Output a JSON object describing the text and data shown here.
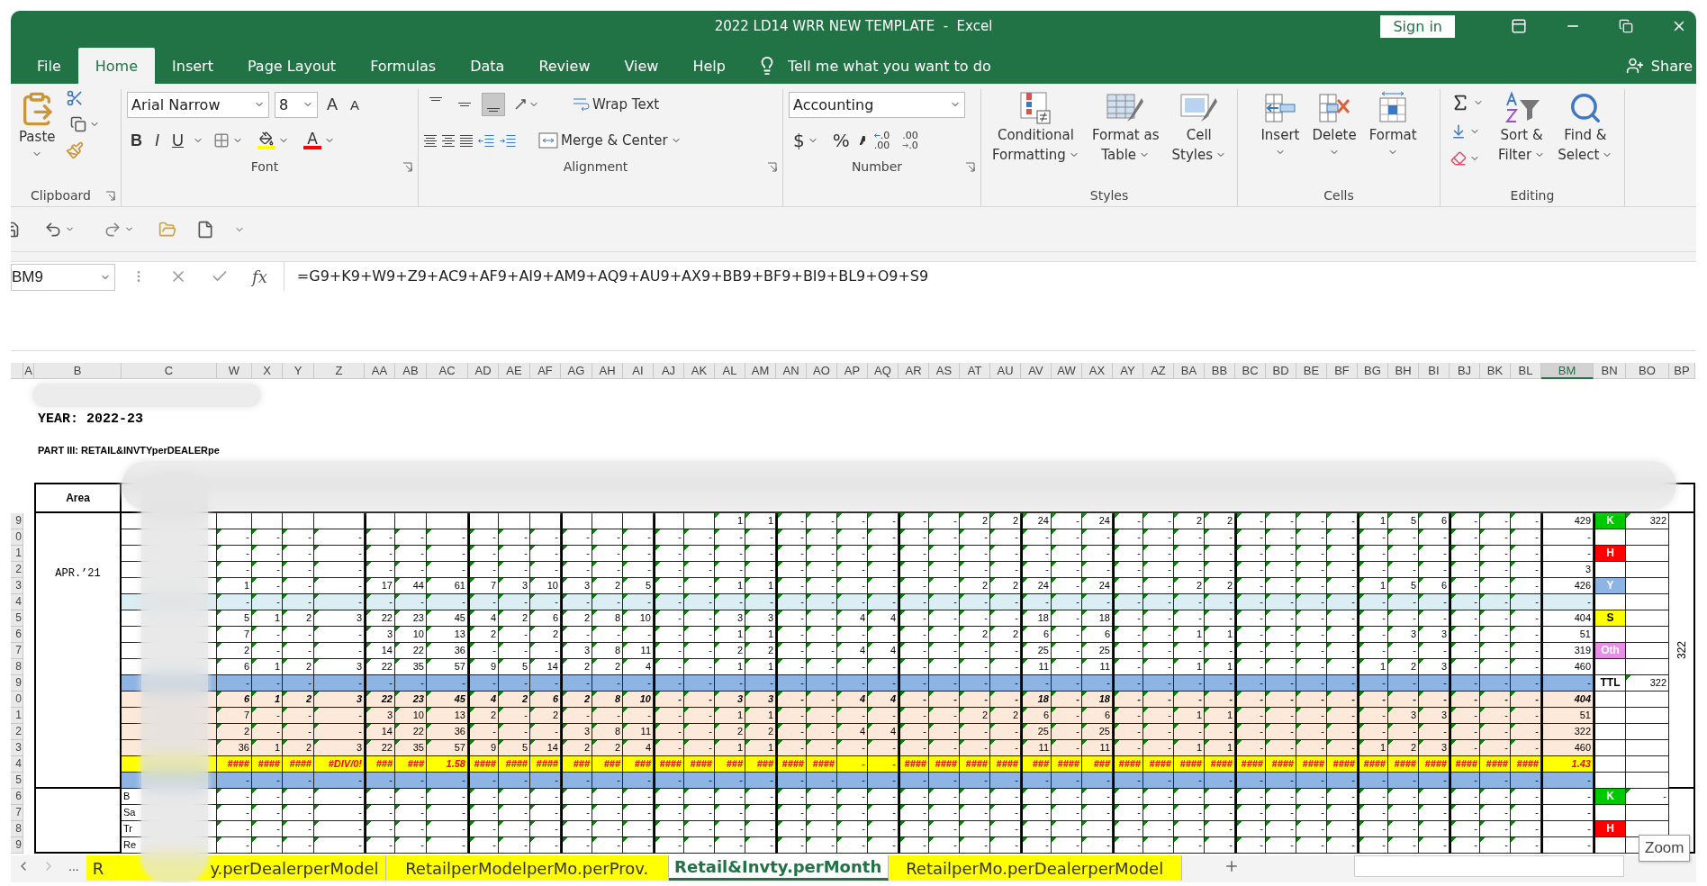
{
  "window": {
    "title": "2022 LD14 WRR NEW TEMPLATE  -  Excel",
    "sign_in": "Sign in"
  },
  "menu_tabs": [
    {
      "label": "File",
      "selected": false
    },
    {
      "label": "Home",
      "selected": true
    },
    {
      "label": "Insert",
      "selected": false
    },
    {
      "label": "Page Layout",
      "selected": false
    },
    {
      "label": "Formulas",
      "selected": false
    },
    {
      "label": "Data",
      "selected": false
    },
    {
      "label": "Review",
      "selected": false
    },
    {
      "label": "View",
      "selected": false
    },
    {
      "label": "Help",
      "selected": false
    }
  ],
  "tell_me": "Tell me what you want to do",
  "share": "Share",
  "ribbon": {
    "clipboard": {
      "label": "Clipboard",
      "paste": "Paste"
    },
    "font": {
      "label": "Font",
      "name": "Arial Narrow",
      "size": "8",
      "grow": "A",
      "shrink": "A",
      "styles": [
        "B",
        "I",
        "U"
      ],
      "color_letter": "A"
    },
    "alignment": {
      "label": "Alignment",
      "vertical": [
        {
          "selected": false
        },
        {
          "selected": false
        },
        {
          "selected": true
        }
      ],
      "wrap": "Wrap Text",
      "merge": "Merge & Center"
    },
    "number": {
      "label": "Number",
      "format": "Accounting",
      "currency": "$",
      "percent": "%",
      "decimals": [
        {
          "kind": "increase",
          "top": ".0",
          "bottom": ".00"
        },
        {
          "kind": "decrease",
          "top": ".00",
          "bottom": ".0"
        }
      ]
    },
    "styles": {
      "label": "Styles",
      "buttons": [
        {
          "kind": "conditional",
          "lines": [
            "Conditional",
            "Formatting"
          ]
        },
        {
          "kind": "table",
          "lines": [
            "Format as",
            "Table"
          ]
        },
        {
          "kind": "cell",
          "lines": [
            "Cell",
            "Styles"
          ]
        }
      ]
    },
    "cells": {
      "label": "Cells",
      "buttons": [
        {
          "kind": "insert",
          "label": "Insert"
        },
        {
          "kind": "delete",
          "label": "Delete"
        },
        {
          "kind": "format",
          "label": "Format"
        }
      ]
    },
    "editing": {
      "label": "Editing",
      "buttons": [
        {
          "kind": "sort",
          "lines": [
            "Sort &",
            "Filter"
          ]
        },
        {
          "kind": "find",
          "lines": [
            "Find &",
            "Select"
          ]
        }
      ]
    }
  },
  "name_box": "BM9",
  "function_label": "fx",
  "formula": "=G9+K9+W9+Z9+AC9+AF9+AI9+AM9+AQ9+AU9+AX9+BB9+BF9+BI9+BL9+O9+S9",
  "sheet": {
    "columns": [
      {
        "label": "A",
        "selected": false
      },
      {
        "label": "B",
        "selected": false
      },
      {
        "label": "C",
        "selected": false
      },
      {
        "label": "W",
        "selected": false
      },
      {
        "label": "X",
        "selected": false
      },
      {
        "label": "Y",
        "selected": false
      },
      {
        "label": "Z",
        "selected": false
      },
      {
        "label": "AA",
        "selected": false
      },
      {
        "label": "AB",
        "selected": false
      },
      {
        "label": "AC",
        "selected": false
      },
      {
        "label": "AD",
        "selected": false
      },
      {
        "label": "AE",
        "selected": false
      },
      {
        "label": "AF",
        "selected": false
      },
      {
        "label": "AG",
        "selected": false
      },
      {
        "label": "AH",
        "selected": false
      },
      {
        "label": "AI",
        "selected": false
      },
      {
        "label": "AJ",
        "selected": false
      },
      {
        "label": "AK",
        "selected": false
      },
      {
        "label": "AL",
        "selected": false
      },
      {
        "label": "AM",
        "selected": false
      },
      {
        "label": "AN",
        "selected": false
      },
      {
        "label": "AO",
        "selected": false
      },
      {
        "label": "AP",
        "selected": false
      },
      {
        "label": "AQ",
        "selected": false
      },
      {
        "label": "AR",
        "selected": false
      },
      {
        "label": "AS",
        "selected": false
      },
      {
        "label": "AT",
        "selected": false
      },
      {
        "label": "AU",
        "selected": false
      },
      {
        "label": "AV",
        "selected": false
      },
      {
        "label": "AW",
        "selected": false
      },
      {
        "label": "AX",
        "selected": false
      },
      {
        "label": "AY",
        "selected": false
      },
      {
        "label": "AZ",
        "selected": false
      },
      {
        "label": "BA",
        "selected": false
      },
      {
        "label": "BB",
        "selected": false
      },
      {
        "label": "BC",
        "selected": false
      },
      {
        "label": "BD",
        "selected": false
      },
      {
        "label": "BE",
        "selected": false
      },
      {
        "label": "BF",
        "selected": false
      },
      {
        "label": "BG",
        "selected": false
      },
      {
        "label": "BH",
        "selected": false
      },
      {
        "label": "BI",
        "selected": false
      },
      {
        "label": "BJ",
        "selected": false
      },
      {
        "label": "BK",
        "selected": false
      },
      {
        "label": "BL",
        "selected": false
      },
      {
        "label": "BM",
        "selected": true
      },
      {
        "label": "BN",
        "selected": false
      },
      {
        "label": "BO",
        "selected": false
      },
      {
        "label": "BP",
        "selected": false
      }
    ],
    "year": "YEAR: 2022-23",
    "part": "PART III: RETAIL&INVTYperDEALERpe",
    "area_header": "Area",
    "period": "APR.’21",
    "side_total": "322",
    "rows": [
      {
        "number": "9",
        "kind": "plain",
        "cells": [
          null,
          null,
          null,
          null,
          null,
          null,
          null,
          null,
          null,
          null,
          null,
          null,
          null,
          null,
          null,
          "1",
          "1",
          "-",
          "-",
          "-",
          "-",
          "-",
          "-",
          "2",
          "2",
          "24",
          "-",
          "24",
          "-",
          "-",
          "2",
          "2",
          "-",
          "-",
          "-",
          "-",
          "1",
          "5",
          "6",
          "-",
          "-",
          "-"
        ],
        "total": "429",
        "tag": {
          "text": "K",
          "color": "#00c800"
        },
        "extra": "322"
      },
      {
        "number": "0",
        "kind": "plain",
        "cells": [
          "-",
          "-",
          "-",
          "-",
          "-",
          "-",
          "-",
          "-",
          "-",
          "-",
          "-",
          "-",
          "-",
          "-",
          "-",
          "-",
          "-",
          "-",
          "-",
          "-",
          "-",
          "-",
          "-",
          "-",
          "-",
          "-",
          "-",
          "-",
          "-",
          "-",
          "-",
          "-",
          "-",
          "-",
          "-",
          "-",
          "-",
          "-",
          "-",
          "-",
          "-",
          "-"
        ],
        "total": "-"
      },
      {
        "number": "1",
        "kind": "plain",
        "cells": [
          "-",
          "-",
          "-",
          "-",
          "-",
          "-",
          "-",
          "-",
          "-",
          "-",
          "-",
          "-",
          "-",
          "-",
          "-",
          "-",
          "-",
          "-",
          "-",
          "-",
          "-",
          "-",
          "-",
          "-",
          "-",
          "-",
          "-",
          "-",
          "-",
          "-",
          "-",
          "-",
          "-",
          "-",
          "-",
          "-",
          "-",
          "-",
          "-",
          "-",
          "-",
          "-"
        ],
        "total": "-",
        "tag": {
          "text": "H",
          "color": "#ff0000"
        }
      },
      {
        "number": "2",
        "kind": "plain",
        "cells": [
          "-",
          "-",
          "-",
          "-",
          "-",
          "-",
          "-",
          "-",
          "-",
          "-",
          "-",
          "-",
          "-",
          "-",
          "-",
          "-",
          "-",
          "-",
          "-",
          "-",
          "-",
          "-",
          "-",
          "-",
          "-",
          "-",
          "-",
          "-",
          "-",
          "-",
          "-",
          "-",
          "-",
          "-",
          "-",
          "-",
          "-",
          "-",
          "-",
          "-",
          "-",
          "-"
        ],
        "total": "3"
      },
      {
        "number": "3",
        "kind": "plain",
        "cells": [
          "1",
          "-",
          "-",
          "-",
          "17",
          "44",
          "61",
          "7",
          "3",
          "10",
          "3",
          "2",
          "5",
          "-",
          "-",
          "1",
          "1",
          "-",
          "-",
          "-",
          "-",
          "-",
          "-",
          "2",
          "2",
          "24",
          "-",
          "24",
          "-",
          "-",
          "2",
          "2",
          "-",
          "-",
          "-",
          "-",
          "1",
          "5",
          "6",
          "-",
          "-",
          "-"
        ],
        "total": "426",
        "tag": {
          "text": "Y",
          "color": "#8db4e2"
        }
      },
      {
        "number": "4",
        "kind": "shaded",
        "cells": [
          "-",
          "-",
          "-",
          "-",
          "-",
          "-",
          "-",
          "-",
          "-",
          "-",
          "-",
          "-",
          "-",
          "-",
          "-",
          "-",
          "-",
          "-",
          "-",
          "-",
          "-",
          "-",
          "-",
          "-",
          "-",
          "-",
          "-",
          "-",
          "-",
          "-",
          "-",
          "-",
          "-",
          "-",
          "-",
          "-",
          "-",
          "-",
          "-",
          "-",
          "-",
          "-"
        ],
        "total": "-"
      },
      {
        "number": "5",
        "kind": "plain",
        "cells": [
          "5",
          "1",
          "2",
          "3",
          "22",
          "23",
          "45",
          "4",
          "2",
          "6",
          "2",
          "8",
          "10",
          "-",
          "-",
          "3",
          "3",
          "-",
          "-",
          "4",
          "4",
          "-",
          "-",
          "-",
          "-",
          "18",
          "-",
          "18",
          "-",
          "-",
          "-",
          "-",
          "-",
          "-",
          "-",
          "-",
          "-",
          "-",
          "-",
          "-",
          "-",
          "-"
        ],
        "total": "404",
        "tag": {
          "text": "S",
          "color": "#ffff00"
        }
      },
      {
        "number": "6",
        "kind": "plain",
        "cells": [
          "7",
          "-",
          "-",
          "-",
          "3",
          "10",
          "13",
          "2",
          "-",
          "2",
          "-",
          "-",
          "-",
          "-",
          "-",
          "1",
          "1",
          "-",
          "-",
          "-",
          "-",
          "-",
          "-",
          "2",
          "2",
          "6",
          "-",
          "6",
          "-",
          "-",
          "1",
          "1",
          "-",
          "-",
          "-",
          "-",
          "-",
          "3",
          "3",
          "-",
          "-",
          "-"
        ],
        "total": "51"
      },
      {
        "number": "7",
        "kind": "plain",
        "cells": [
          "2",
          "-",
          "-",
          "-",
          "14",
          "22",
          "36",
          "-",
          "-",
          "-",
          "3",
          "8",
          "11",
          "-",
          "-",
          "2",
          "2",
          "-",
          "-",
          "4",
          "4",
          "-",
          "-",
          "-",
          "-",
          "25",
          "-",
          "25",
          "-",
          "-",
          "-",
          "-",
          "-",
          "-",
          "-",
          "-",
          "-",
          "-",
          "-",
          "-",
          "-",
          "-"
        ],
        "total": "319",
        "tag": {
          "text": "Oth",
          "color": "#e58fe5"
        }
      },
      {
        "number": "8",
        "kind": "plain",
        "cells": [
          "6",
          "1",
          "2",
          "3",
          "22",
          "35",
          "57",
          "9",
          "5",
          "14",
          "2",
          "2",
          "4",
          "-",
          "-",
          "1",
          "1",
          "-",
          "-",
          "-",
          "-",
          "-",
          "-",
          "-",
          "-",
          "11",
          "-",
          "11",
          "-",
          "-",
          "1",
          "1",
          "-",
          "-",
          "-",
          "-",
          "1",
          "2",
          "3",
          "-",
          "-",
          "-"
        ],
        "total": "460"
      },
      {
        "number": "9",
        "kind": "divider",
        "cells": [
          "-",
          "-",
          "-",
          "-",
          "-",
          "-",
          "-",
          "-",
          "-",
          "-",
          "-",
          "-",
          "-",
          "-",
          "-",
          "-",
          "-",
          "-",
          "-",
          "-",
          "-",
          "-",
          "-",
          "-",
          "-",
          "-",
          "-",
          "-",
          "-",
          "-",
          "-",
          "-",
          "-",
          "-",
          "-",
          "-",
          "-",
          "-",
          "-",
          "-",
          "-",
          "-"
        ],
        "total": "-",
        "tag": {
          "text": "TTL"
        },
        "extra": "322"
      },
      {
        "number": "0",
        "kind": "total",
        "cells": [
          "6",
          "1",
          "2",
          "3",
          "22",
          "23",
          "45",
          "4",
          "2",
          "6",
          "2",
          "8",
          "10",
          "-",
          "-",
          "3",
          "3",
          "-",
          "-",
          "4",
          "4",
          "-",
          "-",
          "-",
          "-",
          "18",
          "-",
          "18",
          "-",
          "-",
          "-",
          "-",
          "-",
          "-",
          "-",
          "-",
          "-",
          "-",
          "-",
          "-",
          "-",
          "-"
        ],
        "total": "404"
      },
      {
        "number": "1",
        "kind": "subtotal",
        "cells": [
          "7",
          "-",
          "-",
          "-",
          "3",
          "10",
          "13",
          "2",
          "-",
          "2",
          "-",
          "-",
          "-",
          "-",
          "-",
          "1",
          "1",
          "-",
          "-",
          "-",
          "-",
          "-",
          "-",
          "2",
          "2",
          "6",
          "-",
          "6",
          "-",
          "-",
          "1",
          "1",
          "-",
          "-",
          "-",
          "-",
          "-",
          "3",
          "3",
          "-",
          "-",
          "-"
        ],
        "total": "51"
      },
      {
        "number": "2",
        "kind": "subtotal",
        "cells": [
          "2",
          "-",
          "-",
          "-",
          "14",
          "22",
          "36",
          "-",
          "-",
          "-",
          "3",
          "8",
          "11",
          "-",
          "-",
          "2",
          "2",
          "-",
          "-",
          "4",
          "4",
          "-",
          "-",
          "-",
          "-",
          "25",
          "-",
          "25",
          "-",
          "-",
          "-",
          "-",
          "-",
          "-",
          "-",
          "-",
          "-",
          "-",
          "-",
          "-",
          "-",
          "-"
        ],
        "total": "322"
      },
      {
        "number": "3",
        "kind": "subtotal",
        "cells": [
          "36",
          "1",
          "2",
          "3",
          "22",
          "35",
          "57",
          "9",
          "5",
          "14",
          "2",
          "2",
          "4",
          "-",
          "-",
          "1",
          "1",
          "-",
          "-",
          "-",
          "-",
          "-",
          "-",
          "-",
          "-",
          "11",
          "-",
          "11",
          "-",
          "-",
          "1",
          "1",
          "-",
          "-",
          "-",
          "-",
          "1",
          "2",
          "3",
          "-",
          "-",
          "-"
        ],
        "total": "460"
      },
      {
        "number": "4",
        "kind": "ratio",
        "cells": [
          "####",
          "####",
          "####",
          "#DIV/0!",
          "###",
          "###",
          "1.58",
          "####",
          "####",
          "####",
          "###",
          "###",
          "###",
          "####",
          "####",
          "###",
          "###",
          "####",
          "####",
          "-",
          "-",
          "####",
          "####",
          "####",
          "####",
          "###",
          "####",
          "###",
          "####",
          "####",
          "####",
          "####",
          "####",
          "####",
          "####",
          "####",
          "####",
          "####",
          "####",
          "####",
          "####",
          "####"
        ],
        "total": "1.43"
      },
      {
        "number": "5",
        "kind": "divider",
        "cells": [
          "-",
          "-",
          "-",
          "-",
          "-",
          "-",
          "-",
          "-",
          "-",
          "-",
          "-",
          "-",
          "-",
          "-",
          "-",
          "-",
          "-",
          "-",
          "-",
          "-",
          "-",
          "-",
          "-",
          "-",
          "-",
          "-",
          "-",
          "-",
          "-",
          "-",
          "-",
          "-",
          "-",
          "-",
          "-",
          "-",
          "-",
          "-",
          "-",
          "-",
          "-",
          "-"
        ],
        "total": "-"
      },
      {
        "number": "6",
        "kind": "plain",
        "label": "B",
        "cells": [
          "-",
          "-",
          "-",
          "-",
          "-",
          "-",
          "-",
          "-",
          "-",
          "-",
          "-",
          "-",
          "-",
          "-",
          "-",
          "-",
          "-",
          "-",
          "-",
          "-",
          "-",
          "-",
          "-",
          "-",
          "-",
          "-",
          "-",
          "-",
          "-",
          "-",
          "-",
          "-",
          "-",
          "-",
          "-",
          "-",
          "-",
          "-",
          "-",
          "-",
          "-",
          "-"
        ],
        "total": "-",
        "tag": {
          "text": "K",
          "color": "#00c800"
        },
        "extra": "-"
      },
      {
        "number": "7",
        "kind": "plain",
        "label": "Sa",
        "cells": [
          "-",
          "-",
          "-",
          "-",
          "-",
          "-",
          "-",
          "-",
          "-",
          "-",
          "-",
          "-",
          "-",
          "-",
          "-",
          "-",
          "-",
          "-",
          "-",
          "-",
          "-",
          "-",
          "-",
          "-",
          "-",
          "-",
          "-",
          "-",
          "-",
          "-",
          "-",
          "-",
          "-",
          "-",
          "-",
          "-",
          "-",
          "-",
          "-",
          "-",
          "-",
          "-"
        ],
        "total": "-"
      },
      {
        "number": "8",
        "kind": "plain",
        "label": "Tr",
        "cells": [
          "-",
          "-",
          "-",
          "-",
          "-",
          "-",
          "-",
          "-",
          "-",
          "-",
          "-",
          "-",
          "-",
          "-",
          "-",
          "-",
          "-",
          "-",
          "-",
          "-",
          "-",
          "-",
          "-",
          "-",
          "-",
          "-",
          "-",
          "-",
          "-",
          "-",
          "-",
          "-",
          "-",
          "-",
          "-",
          "-",
          "-",
          "-",
          "-",
          "-",
          "-",
          "-"
        ],
        "total": "-",
        "tag": {
          "text": "H",
          "color": "#ff0000"
        }
      },
      {
        "number": "9",
        "kind": "plain",
        "label": "Re",
        "cells": [
          "-",
          "-",
          "-",
          "-",
          "-",
          "-",
          "-",
          "-",
          "-",
          "-",
          "-",
          "-",
          "-",
          "-",
          "-",
          "-",
          "-",
          "-",
          "-",
          "-",
          "-",
          "-",
          "-",
          "-",
          "-",
          "-",
          "-",
          "-",
          "-",
          "-",
          "-",
          "-",
          "-",
          "-",
          "-",
          "-",
          "-",
          "-",
          "-",
          "-",
          "-",
          "-"
        ],
        "total": "-"
      }
    ]
  },
  "sheet_tabs": [
    {
      "label": "R",
      "label_end": "y.perDealerperModel",
      "selected": false
    },
    {
      "label": "RetailperModelperMo.perProv.",
      "selected": false
    },
    {
      "label": "Retail&Invty.perMonth",
      "selected": true
    },
    {
      "label": "RetailperMo.perDealerperModel",
      "selected": false
    }
  ],
  "more_tabs": "...",
  "zoom_tooltip": "Zoom"
}
